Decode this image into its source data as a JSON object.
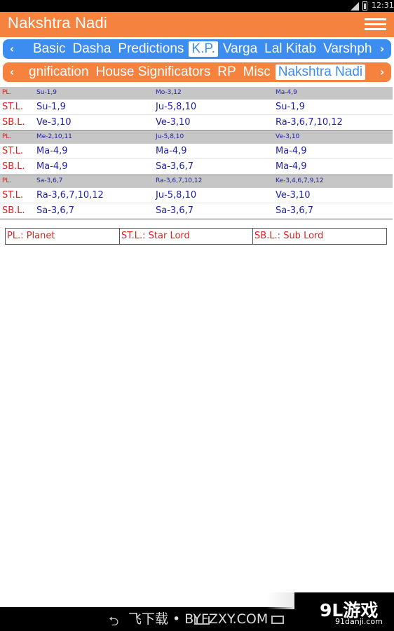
{
  "status_bar": {
    "time": "12:31",
    "signal_icon": "signal-icon",
    "battery_icon": "battery-icon"
  },
  "app_bar": {
    "title": "Nakshtra Nadi",
    "menu_icon": "hamburger-menu-icon"
  },
  "tab_strip_1": {
    "tabs": [
      "Basic",
      "Dasha",
      "Predictions",
      "K.P.",
      "Varga",
      "Lal Kitab",
      "Varshph"
    ],
    "active": "K.P."
  },
  "tab_strip_2": {
    "tabs": [
      "gnification",
      "House Significators",
      "RP",
      "Misc",
      "Nakshtra Nadi"
    ],
    "active": "Nakshtra Nadi"
  },
  "table": {
    "labels": {
      "planet": "PL.",
      "star_lord": "ST.L.",
      "sub_lord": "SB.L."
    },
    "blocks": [
      {
        "planets": [
          "Su-1,9",
          "Mo-3,12",
          "Ma-4,9"
        ],
        "star_lords": [
          "Su-1,9",
          "Ju-5,8,10",
          "Su-1,9"
        ],
        "sub_lords": [
          "Ve-3,10",
          "Ve-3,10",
          "Ra-3,6,7,10,12"
        ]
      },
      {
        "planets": [
          "Me-2,10,11",
          "Ju-5,8,10",
          "Ve-3,10"
        ],
        "star_lords": [
          "Ma-4,9",
          "Ma-4,9",
          "Ma-4,9"
        ],
        "sub_lords": [
          "Ma-4,9",
          "Sa-3,6,7",
          "Ma-4,9"
        ]
      },
      {
        "planets": [
          "Sa-3,6,7",
          "Ra-3,6,7,10,12",
          "Ke-3,4,6,7,9,12"
        ],
        "star_lords": [
          "Ra-3,6,7,10,12",
          "Ju-5,8,10",
          "Ve-3,10"
        ],
        "sub_lords": [
          "Sa-3,6,7",
          "Sa-3,6,7",
          "Sa-3,6,7"
        ]
      }
    ]
  },
  "legend": [
    "PL.: Planet",
    "ST.L.: Star Lord",
    "SB.L.: Sub Lord"
  ],
  "watermark": {
    "text": "飞下载 • BYFZXY.COM",
    "logo_text": "9L游戏",
    "logo_url": "91danji.com"
  },
  "colors": {
    "orange": "#f5823f",
    "blue": "#3d8df0",
    "label_red": "#e01e1e",
    "value_blue": "#1f1fa8"
  }
}
